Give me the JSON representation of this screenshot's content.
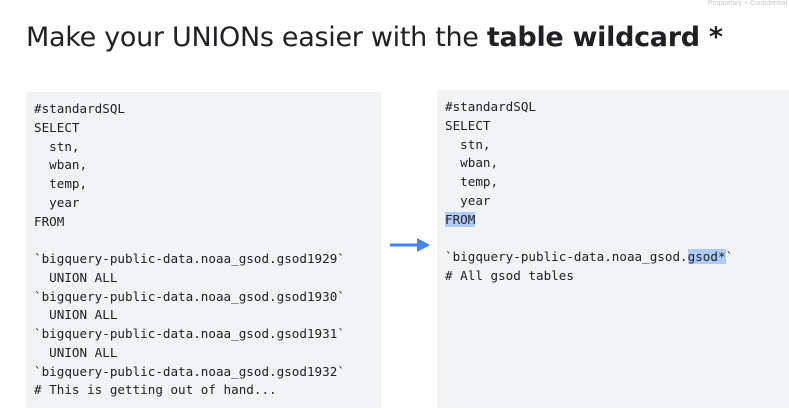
{
  "watermark": "Proprietary + Confidential",
  "title": {
    "prefix": "Make your UNIONs easier with the ",
    "bold": "table wildcard *"
  },
  "left_code": {
    "lines": [
      "#standardSQL",
      "SELECT",
      "  stn,",
      "  wban,",
      "  temp,",
      "  year",
      "FROM",
      "",
      "`bigquery-public-data.noaa_gsod.gsod1929`",
      "  UNION ALL",
      "`bigquery-public-data.noaa_gsod.gsod1930`",
      "  UNION ALL",
      "`bigquery-public-data.noaa_gsod.gsod1931`",
      "  UNION ALL",
      "`bigquery-public-data.noaa_gsod.gsod1932`",
      "# This is getting out of hand..."
    ]
  },
  "right_code": {
    "line1": "#standardSQL",
    "line2": "SELECT",
    "line3": "  stn,",
    "line4": "  wban,",
    "line5": "  temp,",
    "line6": "  year",
    "from_keyword": "FROM",
    "table_prefix": "`bigquery-public-data.noaa_gsod.",
    "table_wildcard": "gsod*",
    "table_suffix": "`",
    "comment": "# All gsod tables"
  },
  "colors": {
    "arrow": "#4285f4",
    "highlight": "#aecbfa",
    "panel_bg": "#f1f3f4",
    "text": "#202124"
  },
  "icons": {
    "arrow": "right-arrow-icon"
  }
}
